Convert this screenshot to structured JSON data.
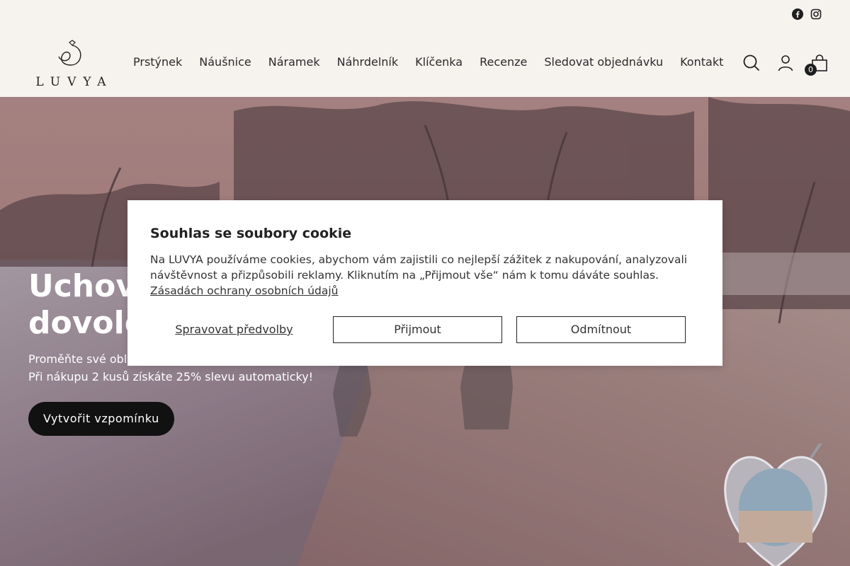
{
  "brand": {
    "logo_text": "LUVYA"
  },
  "social": {
    "icons": [
      "facebook-icon",
      "instagram-icon"
    ]
  },
  "nav": {
    "items": [
      {
        "label": "Prstýnek"
      },
      {
        "label": "Náušnice"
      },
      {
        "label": "Náramek"
      },
      {
        "label": "Náhrdelník"
      },
      {
        "label": "Klíčenka"
      },
      {
        "label": "Recenze"
      },
      {
        "label": "Sledovat objednávku"
      },
      {
        "label": "Kontakt"
      }
    ]
  },
  "header_icons": {
    "search": "search-icon",
    "account": "user-icon",
    "cart": "bag-icon",
    "cart_count": "0"
  },
  "hero": {
    "title_line1": "Uchov",
    "title_line2": "dovole",
    "subtitle_line1": "Proměňte své oblí",
    "subtitle_line2": "Při nákupu 2 kusů získáte 25% slevu automaticky!",
    "cta_label": "Vytvořit vzpomínku"
  },
  "cookie": {
    "title": "Souhlas se soubory cookie",
    "text": "Na LUVYA používáme cookies, abychom vám zajistili co nejlepší zážitek z nakupování, analyzovali návštěvnost a přizpůsobili reklamy. Kliknutím na „Přijmout vše“ nám k tomu dáváte souhlas.",
    "link": "Zásadách ochrany osobních údajů",
    "manage_label": "Spravovat předvolby",
    "accept_label": "Přijmout",
    "reject_label": "Odmítnout"
  },
  "colors": {
    "background": "#f6f3ef",
    "button_dark": "#111111",
    "text": "#1e1e1e"
  }
}
